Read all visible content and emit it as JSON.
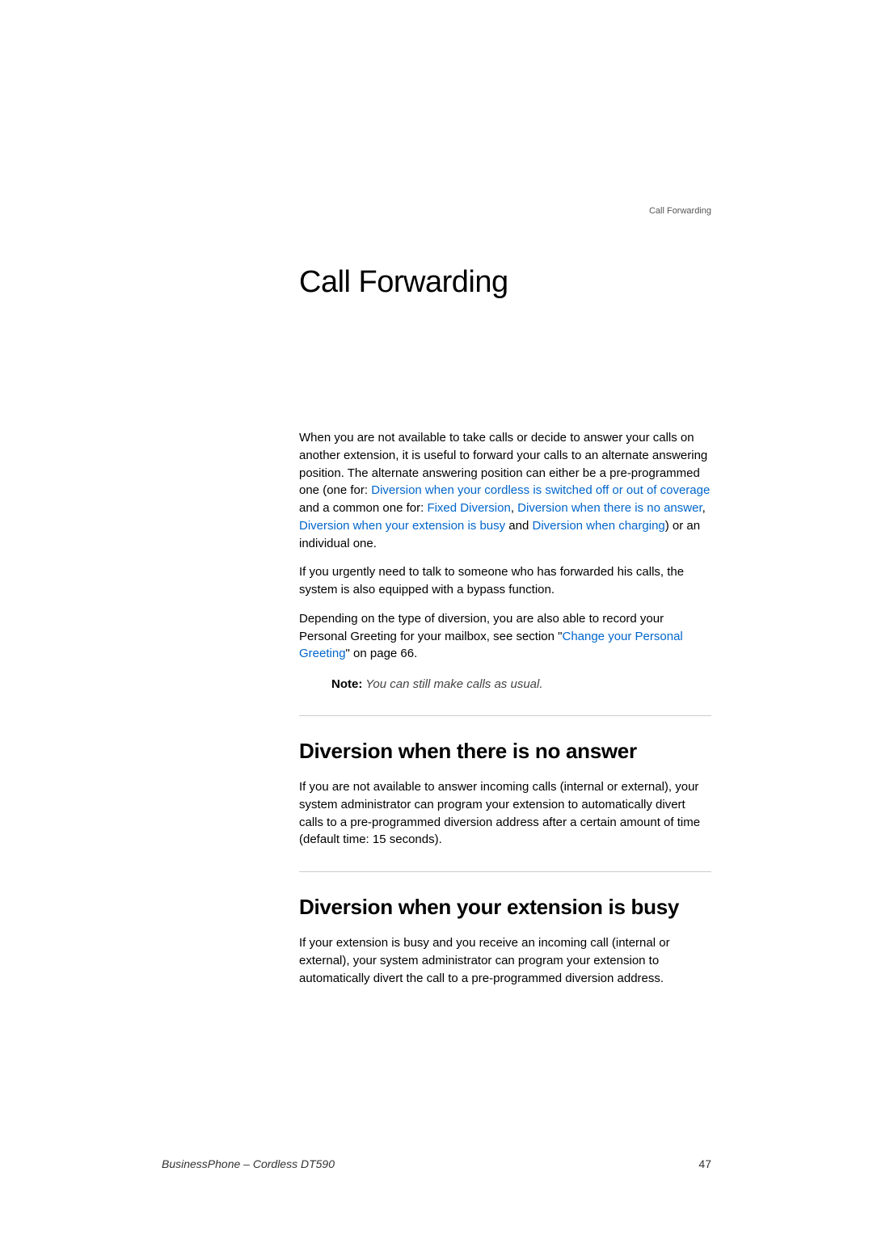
{
  "header": {
    "topRight": "Call Forwarding"
  },
  "main": {
    "title": "Call Forwarding",
    "para1_part1": "When you are not available to take calls or decide to answer your calls on another extension, it is useful to forward your calls to an alternate answering position. The alternate answering position can either be a pre-programmed one (one for: ",
    "link1": "Diversion when your cordless is switched off or out of coverage",
    "para1_part2": " and a common one for: ",
    "link2": "Fixed Diversion",
    "para1_part3": ", ",
    "link3": "Diversion when there is no answer",
    "para1_part4": ", ",
    "link4": "Diversion when your extension is busy",
    "para1_part5": " and ",
    "link5": "Diversion when charging",
    "para1_part6": ") or an individual one.",
    "para2": "If you urgently need to talk to someone who has forwarded his calls, the system is also equipped with a bypass function.",
    "para3_part1": "Depending on the type of diversion, you are also able to record your Personal Greeting for your mailbox, see section \"",
    "link6": "Change your Personal Greeting",
    "para3_part2": "\" on page 66.",
    "noteLabel": "Note:",
    "noteText": " You can still make calls as usual."
  },
  "section1": {
    "heading": "Diversion when there is no answer",
    "text": "If you are not available to answer incoming calls (internal or external), your system administrator can program your extension to automatically divert calls to a pre-programmed diversion address after a certain amount of time (default time: 15 seconds)."
  },
  "section2": {
    "heading": "Diversion when your extension is busy",
    "text": "If your extension is busy and you receive an incoming call (internal or external), your system administrator can program your extension to automatically divert the call to a pre-programmed diversion address."
  },
  "footer": {
    "left": "BusinessPhone – Cordless DT590",
    "right": "47"
  }
}
